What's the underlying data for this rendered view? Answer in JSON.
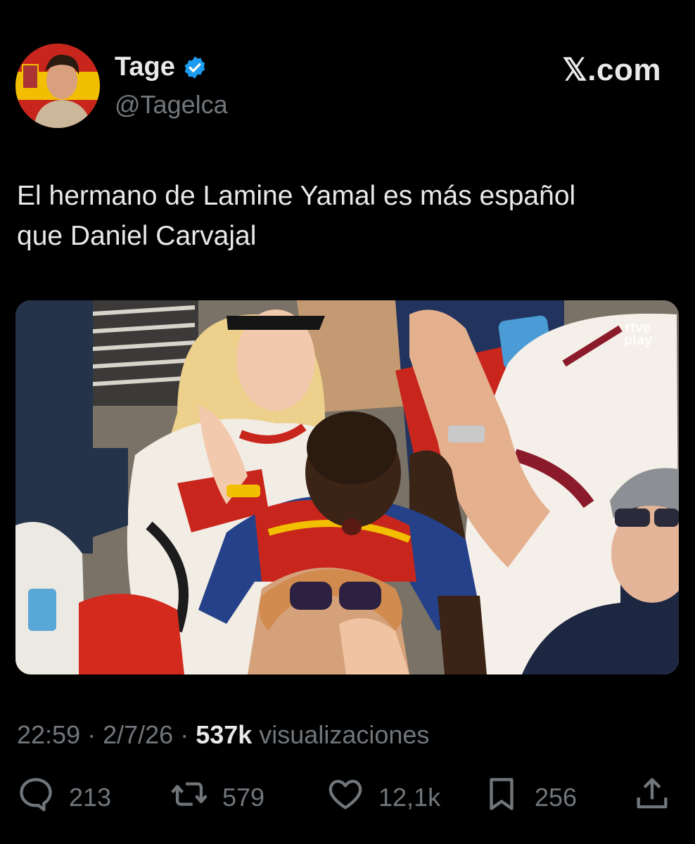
{
  "user": {
    "display_name": "Tage",
    "handle": "@Tagelca",
    "verified_color": "#1d9bf0"
  },
  "brand": "𝕏.com",
  "tweet": {
    "text": "El hermano de Lamine Yamal es más español\nque Daniel Carvajal"
  },
  "media": {
    "watermark_top": "rtve",
    "watermark_bottom": "play"
  },
  "meta": {
    "time": "22:59",
    "date": "2/7/26",
    "views_count": "537k",
    "views_label": "visualizaciones",
    "separator": "·"
  },
  "actions": {
    "replies": {
      "icon": "reply-icon",
      "count": "213"
    },
    "reposts": {
      "icon": "repost-icon",
      "count": "579"
    },
    "likes": {
      "icon": "heart-icon",
      "count": "12,1k"
    },
    "bookmarks": {
      "icon": "bookmark-icon",
      "count": "256"
    },
    "share": {
      "icon": "share-icon"
    }
  }
}
